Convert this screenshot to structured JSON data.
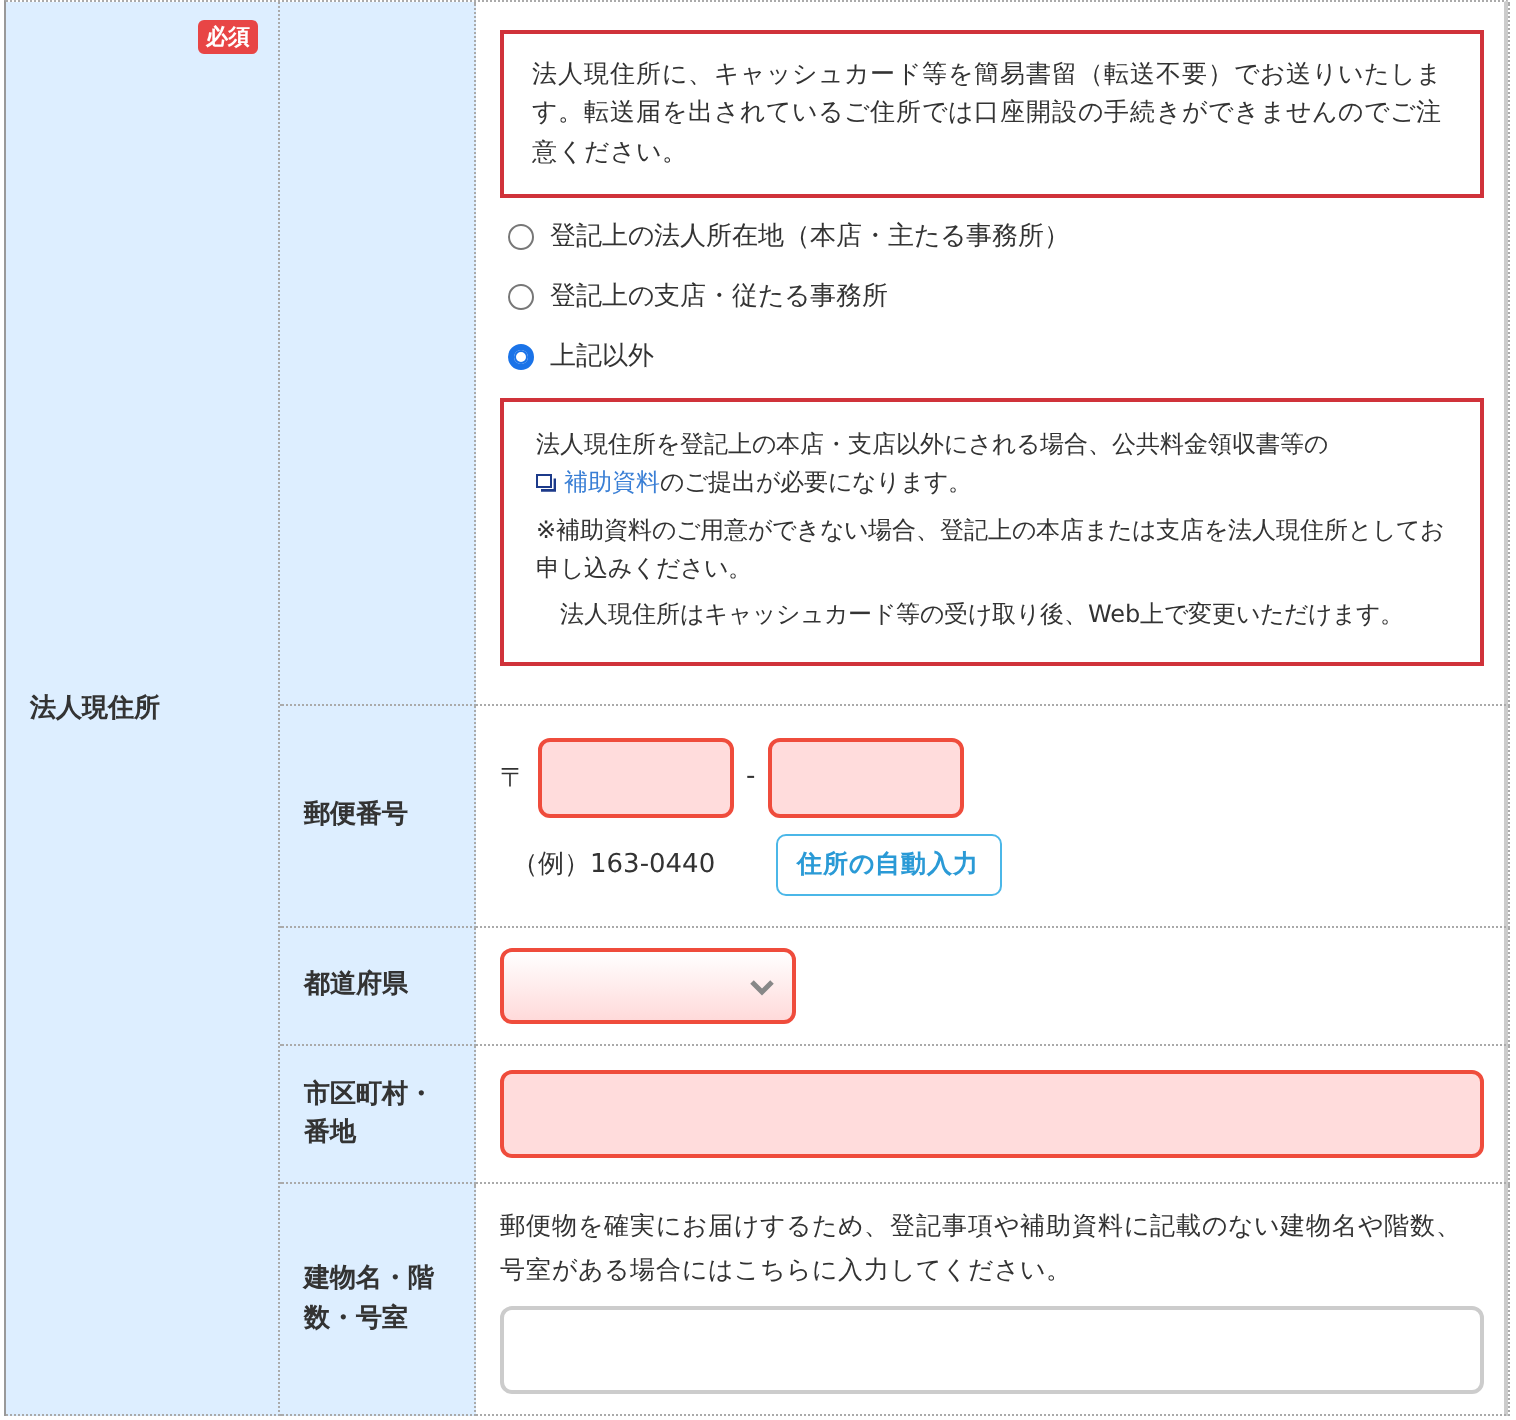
{
  "section": {
    "label": "法人現住所",
    "badge": "必須"
  },
  "notice": "法人現住所に、キャッシュカード等を簡易書留（転送不要）でお送りいたします。転送届を出されているご住所では口座開設の手続きができませんのでご注意ください。",
  "address_options": [
    {
      "label": "登記上の法人所在地（本店・主たる事務所）",
      "selected": false
    },
    {
      "label": "登記上の支店・従たる事務所",
      "selected": false
    },
    {
      "label": "上記以外",
      "selected": true
    }
  ],
  "other_notice": {
    "text_before": "法人現住所を登記上の本店・支店以外にされる場合、公共料金領収書等の",
    "link": "補助資料",
    "text_after": "のご提出が必要になります。",
    "notes": [
      "※補助資料のご用意ができない場合、登記上の本店または支店を法人現住所としてお申し込みください。",
      "法人現住所はキャッシュカード等の受け取り後、Web上で変更いただけます。"
    ]
  },
  "fields": [
    {
      "kind": "postal",
      "label": "郵便番号",
      "prefix": "〒",
      "separator": "-",
      "invalid": true,
      "example": "（例）163-0440",
      "button": "住所の自動入力"
    },
    {
      "kind": "select",
      "label": "都道府県",
      "invalid": true
    },
    {
      "kind": "text",
      "label": "市区町村・番地",
      "invalid": true
    },
    {
      "kind": "text",
      "label": "建物名・階数・号室",
      "hint": "郵便物を確実にお届けするため、登記事項や補助資料に記載のない建物名や階数、号室がある場合にはこちらに入力してください。",
      "invalid": false
    }
  ]
}
